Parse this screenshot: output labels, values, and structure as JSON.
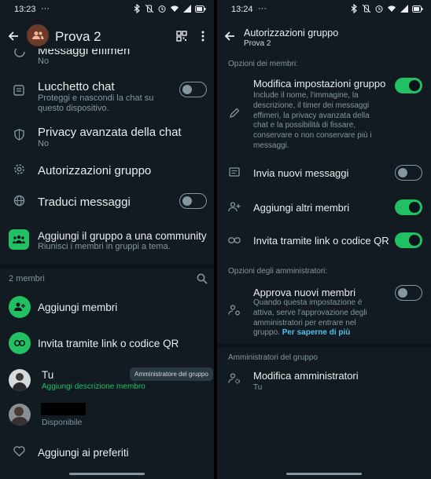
{
  "left": {
    "status": {
      "time": "13:23",
      "dots": "···"
    },
    "header": {
      "title": "Prova 2"
    },
    "items": [
      {
        "title": "Messaggi effimeri",
        "subtitle": "No"
      },
      {
        "title": "Lucchetto chat",
        "subtitle": "Proteggi e nascondi la chat su questo dispositivo."
      },
      {
        "title": "Privacy avanzata della chat",
        "subtitle": "No"
      },
      {
        "title": "Autorizzazioni gruppo"
      },
      {
        "title": "Traduci messaggi"
      },
      {
        "title": "Aggiungi il gruppo a una community",
        "subtitle": "Riunisci i membri in gruppi a tema."
      }
    ],
    "members_count": "2 membri",
    "add_members": "Aggiungi membri",
    "invite_link": "Invita tramite link o codice QR",
    "member_you": {
      "name": "Tu",
      "action": "Aggiungi descrizione membro",
      "badge": "Amministratore del gruppo"
    },
    "member_other": {
      "status": "Disponibile"
    },
    "favorites": "Aggiungi ai preferiti"
  },
  "right": {
    "status": {
      "time": "13:24",
      "dots": "···"
    },
    "header": {
      "title": "Autorizzazioni gruppo",
      "subtitle": "Prova 2"
    },
    "members_section": "Opzioni dei membri:",
    "edit_settings": {
      "title": "Modifica impostazioni gruppo",
      "desc": "Include il nome, l'immagine, la descrizione, il timer dei messaggi effimeri, la privacy avanzata della chat e la possibilità di fissare, conservare o non conservare più i messaggi."
    },
    "send_messages": "Invia nuovi messaggi",
    "add_members": "Aggiungi altri membri",
    "invite_link": "Invita tramite link o codice QR",
    "admins_section": "Opzioni degli amministratori:",
    "approve": {
      "title": "Approva nuovi membri",
      "desc": "Quando questa impostazione è attiva, serve l'approvazione degli amministratori per entrare nel gruppo.",
      "link": "Per saperne di più"
    },
    "group_admins": "Amministratori del gruppo",
    "edit_admins": {
      "title": "Modifica amministratori",
      "subtitle": "Tu"
    }
  },
  "colors": {
    "accent": "#21c063",
    "background": "#111b21",
    "secondary_text": "#8696a0",
    "link": "#53bdeb"
  },
  "toggles": {
    "chat_lock": false,
    "translate": false,
    "edit_settings": true,
    "send_messages": false,
    "add_members": true,
    "invite_link": true,
    "approve": false
  }
}
